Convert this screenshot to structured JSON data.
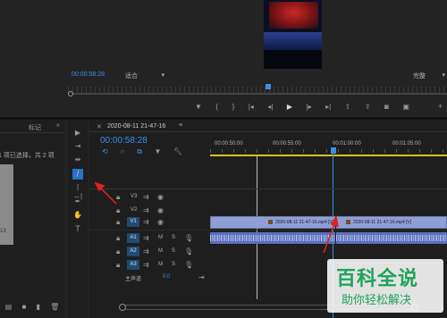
{
  "program_monitor": {
    "timecode": "00:00:58:28",
    "fit_label": "适合",
    "quality_label": "完整",
    "transport_icons": [
      "marker-icon",
      "in-point-icon",
      "out-point-icon",
      "go-to-in-icon",
      "step-back-icon",
      "play-icon",
      "step-forward-icon",
      "go-to-out-icon",
      "lift-icon",
      "extract-icon",
      "export-frame-icon",
      "button-editor-icon"
    ]
  },
  "left_panel": {
    "tab_label": "标记",
    "selection_text": "1 项已选择，共 2 项",
    "thumb_duration": "13"
  },
  "tools": [
    "selection-tool",
    "track-select-tool",
    "ripple-edit-tool",
    "razor-tool",
    "slip-tool",
    "pen-tool",
    "hand-tool",
    "type-tool"
  ],
  "timeline": {
    "sequence_name": "2020-08-11 21-47-16",
    "timecode": "00:00:58:28",
    "ruler": [
      "00:00:50:00",
      "00:00:55:00",
      "00:01:00:00",
      "00:01:05:00"
    ],
    "video_tracks": [
      "V3",
      "V2",
      "V1"
    ],
    "audio_tracks": [
      "A1",
      "A2",
      "A3"
    ],
    "master_label": "主声道",
    "master_value": "0.0",
    "clip_left": "2020-08-11 21-47-16.mp4 [V]",
    "clip_right": "2020-08-11 21-47-16.mp4 [V]"
  },
  "watermark": {
    "title": "百科全说",
    "subtitle": "助你轻松解决"
  },
  "colors": {
    "accent": "#3d8ee8",
    "clip": "#8f9fd6",
    "annotation": "#e02020",
    "watermark": "#1fa35a"
  }
}
